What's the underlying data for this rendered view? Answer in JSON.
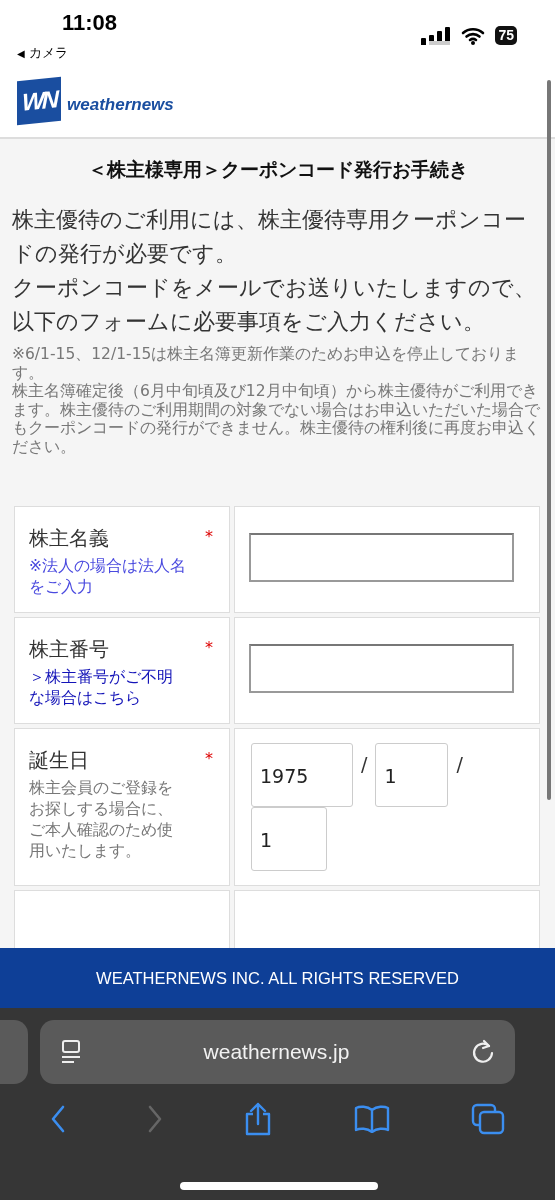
{
  "status_bar": {
    "time": "11:08",
    "back_arrow": "◀",
    "back_label": "カメラ",
    "battery": "75"
  },
  "site_header": {
    "logo_mark": "WN",
    "logo_text": "weathernews"
  },
  "page": {
    "title": "＜株主様専用＞クーポンコード発行お手続き",
    "intro": [
      "株主優待のご利用には、株主優待専用クーポンコードの発行が必要です。",
      "クーポンコードをメールでお送りいたしますので、以下のフォームに必要事項をご入力ください。"
    ],
    "notes": [
      "※6/1-15、12/1-15は株主名簿更新作業のためお申込を停止しております。",
      "株主名簿確定後（6月中旬頃及び12月中旬頃）から株主優待がご利用できます。株主優待のご利用期間の対象でない場合はお申込いただいた場合でもクーポンコードの発行ができません。株主優待の権利後に再度お申込ください。"
    ]
  },
  "form": {
    "rows": [
      {
        "kind": "text",
        "label": "株主名義",
        "required_mark": "*",
        "hint": {
          "kind": "note",
          "text": "※法人の場合は法人名をご入力"
        }
      },
      {
        "kind": "text",
        "label": "株主番号",
        "required_mark": "*",
        "hint": {
          "kind": "link",
          "text": "＞株主番号がご不明な場合はこちら"
        }
      },
      {
        "kind": "date",
        "label": "誕生日",
        "required_mark": "*",
        "hint": {
          "kind": "plain",
          "text": "株主会員のご登録をお探しする場合に、ご本人確認のため使用いたします。"
        },
        "values": [
          "1975",
          "1",
          "1"
        ],
        "separators": [
          "/",
          "/"
        ]
      },
      {
        "kind": "cut"
      }
    ]
  },
  "footer": {
    "text": "WEATHERNEWS INC. ALL RIGHTS RESERVED"
  },
  "browser": {
    "url": "weathernews.jp"
  }
}
